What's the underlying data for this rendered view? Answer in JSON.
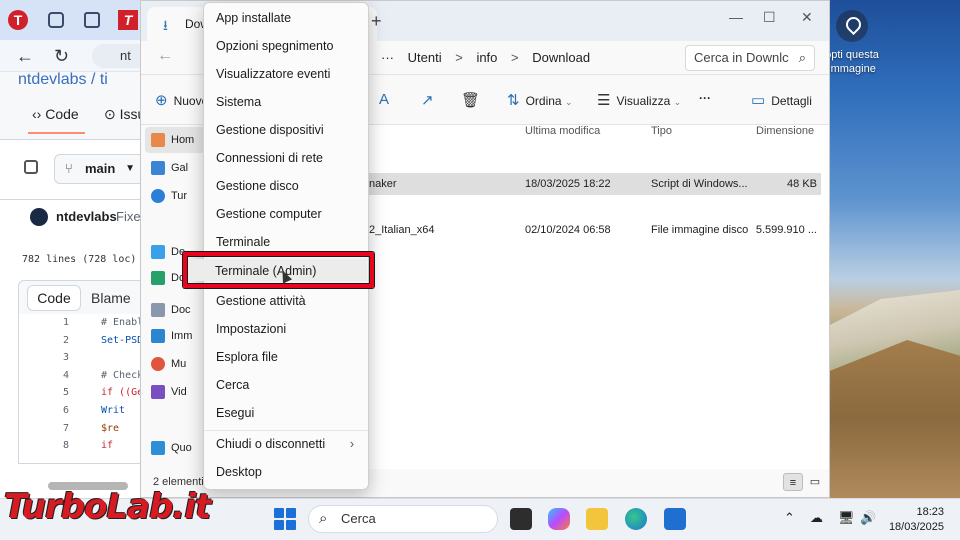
{
  "desktop": {
    "hint_line1": "opti questa",
    "hint_line2": "immagine"
  },
  "browser": {
    "tab_logo": "T",
    "address_partial": "nt",
    "repo_partial": "ntdevlabs / ti",
    "tab_code": "Code",
    "tab_issues": "Issu",
    "branch": "main",
    "commit_user": "ntdevlabs",
    "commit_msg": "Fixes",
    "lines_info": "782 lines (728 loc) ·",
    "btn_code": "Code",
    "btn_blame": "Blame",
    "code_lines": [
      {
        "n": "1",
        "t": "# Enabl"
      },
      {
        "n": "2",
        "t": "Set-PSD"
      },
      {
        "n": "3",
        "t": ""
      },
      {
        "n": "4",
        "t": "# Check"
      },
      {
        "n": "5",
        "t": "if ((Ge"
      },
      {
        "n": "6",
        "t": "  Writ"
      },
      {
        "n": "7",
        "t": "  $re"
      },
      {
        "n": "8",
        "t": "  if"
      }
    ]
  },
  "explorer": {
    "tab_title": "Downl",
    "new_tab": "+",
    "breadcrumb": [
      "···",
      "Utenti",
      ">",
      "info",
      ">",
      "Download"
    ],
    "search_placeholder": "Cerca in Downlc",
    "cmd_new": "Nuovo",
    "cmd_sort": "Ordina",
    "cmd_view": "Visualizza",
    "cmd_more": "···",
    "cmd_details": "Dettagli",
    "sidebar": [
      "Hom",
      "Gal",
      "Tur",
      "De",
      "Do",
      "Doc",
      "Imm",
      "Mu",
      "Vid",
      "Quo"
    ],
    "columns": {
      "modified": "Ultima modifica",
      "type": "Tipo",
      "size": "Dimensione"
    },
    "files": [
      {
        "name": "naker",
        "modified": "18/03/2025 18:22",
        "type": "Script di Windows...",
        "size": "48 KB"
      },
      {
        "name": "2_Italian_x64",
        "modified": "02/10/2024 06:58",
        "type": "File immagine disco",
        "size": "5.599.910 ..."
      }
    ],
    "status": "2 elementi"
  },
  "context_menu": {
    "items": [
      "App installate",
      "Opzioni spegnimento",
      "Visualizzatore eventi",
      "Sistema",
      "Gestione dispositivi",
      "Connessioni di rete",
      "Gestione disco",
      "Gestione computer",
      "Terminale",
      "Terminale (Admin)",
      "Gestione attività",
      "Impostazioni",
      "Esplora file",
      "Cerca",
      "Esegui",
      "Chiudi o disconnetti",
      "Desktop"
    ],
    "highlighted": "Terminale (Admin)",
    "highlight_color": "#e8061e"
  },
  "taskbar": {
    "brand": "TurboLab.it",
    "search": "Cerca",
    "time": "18:23",
    "date": "18/03/2025"
  }
}
